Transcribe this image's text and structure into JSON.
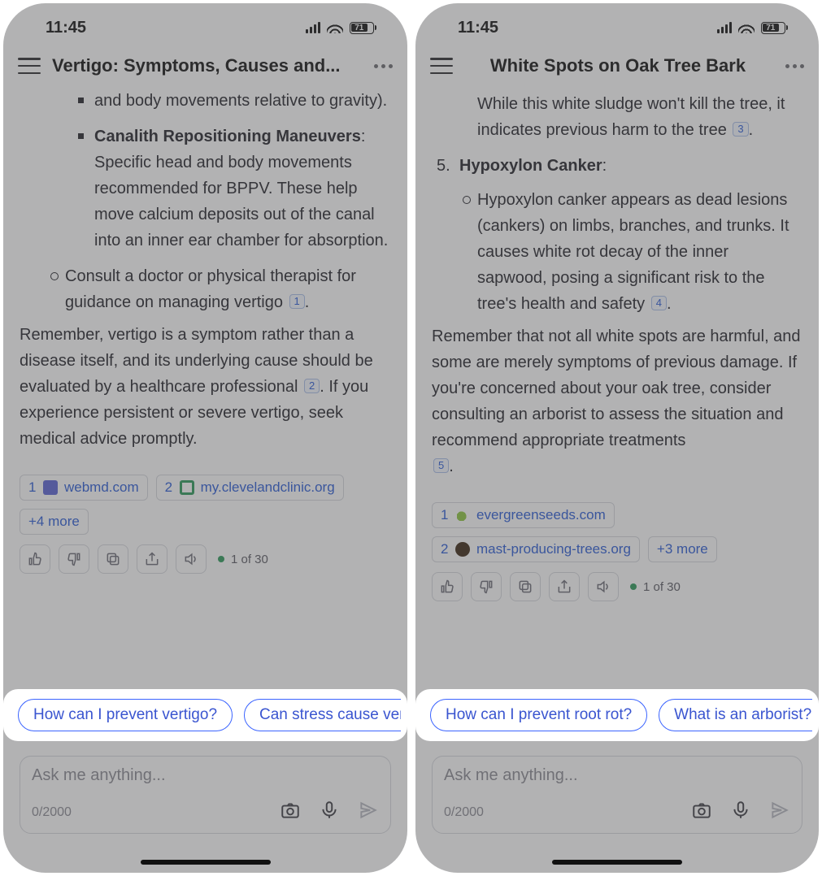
{
  "status": {
    "time": "11:45",
    "battery": "71"
  },
  "left": {
    "title": "Vertigo: Symptoms, Causes and...",
    "content": {
      "li_trail": "and body movements relative to gravity).",
      "li_canalith_label": "Canalith Repositioning Maneuvers",
      "li_canalith_text": ": Specific head and body movements recommended for BPPV. These help move calcium deposits out of the canal into an inner ear chamber for absorption.",
      "li_consult": "Consult a doctor or physical therapist for guidance on managing vertigo",
      "cite1": "1",
      "para": "Remember, vertigo is a symptom rather than a disease itself, and its underlying cause should be evaluated by a healthcare professional",
      "cite2": "2",
      "para_tail": ". If you experience persistent or severe vertigo, seek medical advice promptly."
    },
    "sources": {
      "s1_num": "1",
      "s1_host": "webmd.com",
      "s2_num": "2",
      "s2_host": "my.clevelandclinic.org",
      "more": "+4 more"
    },
    "pager": "1 of 30",
    "suggestions": {
      "a": "How can I prevent vertigo?",
      "b": "Can stress cause vertigo?"
    },
    "input": {
      "placeholder": "Ask me anything...",
      "counter": "0/2000"
    }
  },
  "right": {
    "title": "White Spots on Oak Tree Bark",
    "content": {
      "lead": "While this white sludge won't kill the tree, it indicates previous harm to the tree",
      "cite3": "3",
      "num5": "5.",
      "hypo_label": "Hypoxylon Canker",
      "hypo_colon": ":",
      "hypo_body": "Hypoxylon canker appears as dead lesions (cankers) on limbs, branches, and trunks. It causes white rot decay of the inner sapwood, posing a significant risk to the tree's health and safety",
      "cite4": "4",
      "para": "Remember that not all white spots are harmful, and some are merely symptoms of previous damage. If you're concerned about your oak tree, consider consulting an arborist to assess the situation and recommend appropriate treatments",
      "cite5": "5",
      "period": "."
    },
    "sources": {
      "s1_num": "1",
      "s1_host": "evergreenseeds.com",
      "s2_num": "2",
      "s2_host": "mast-producing-trees.org",
      "more": "+3 more"
    },
    "pager": "1 of 30",
    "suggestions": {
      "a": "How can I prevent root rot?",
      "b": "What is an arborist?"
    },
    "input": {
      "placeholder": "Ask me anything...",
      "counter": "0/2000"
    }
  }
}
